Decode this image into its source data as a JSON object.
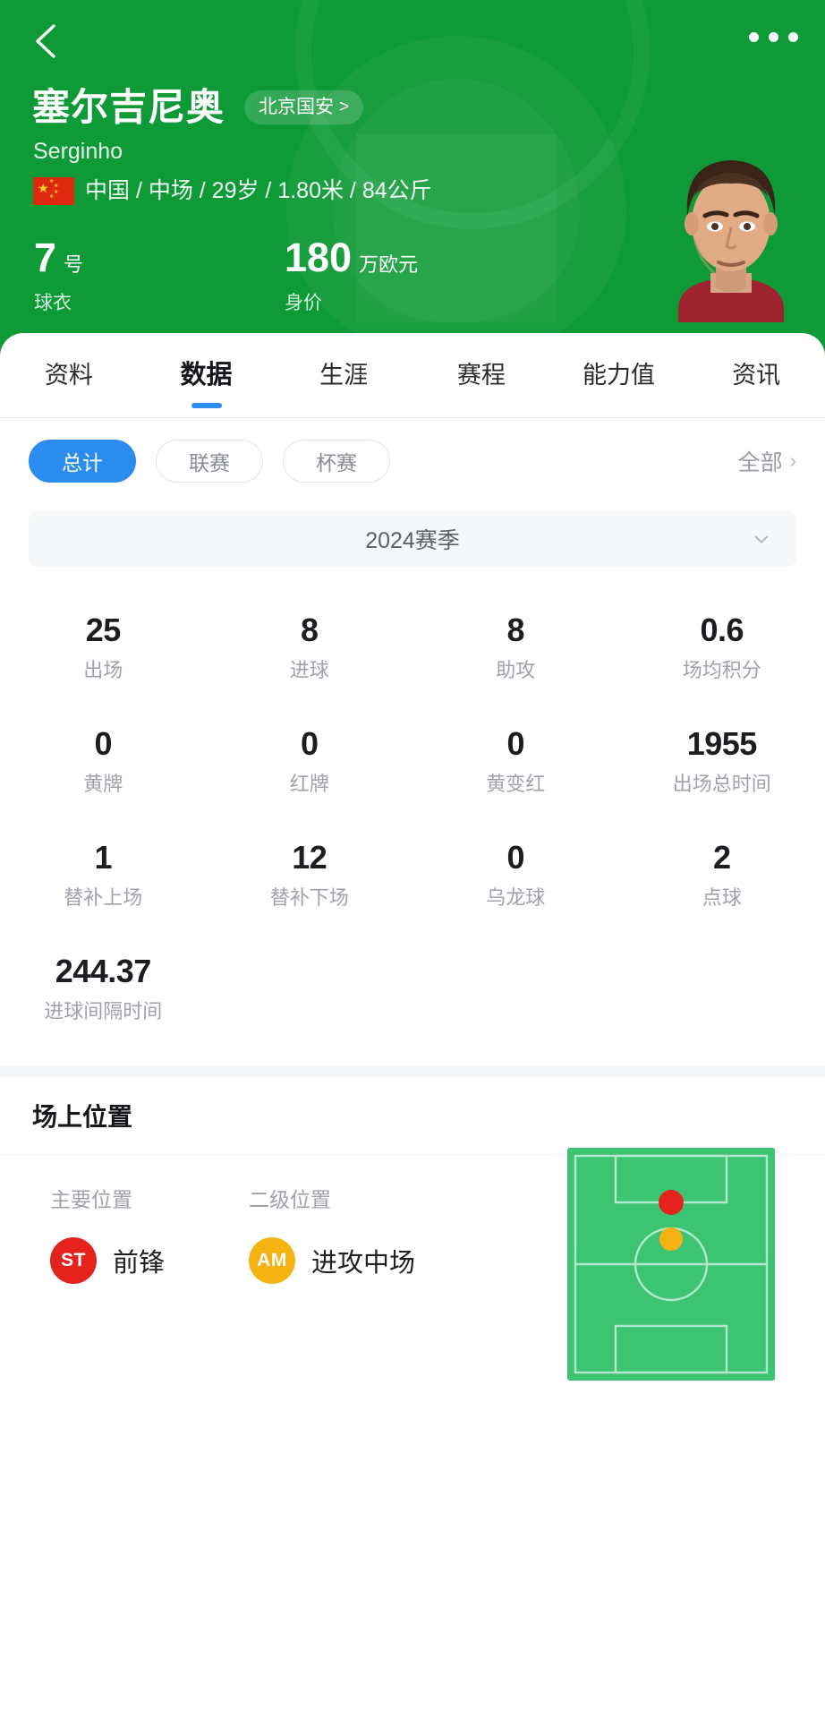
{
  "topbar": {
    "back_icon": "chevron-left-icon",
    "more_icon": "more-horizontal-icon"
  },
  "player": {
    "name": "塞尔吉尼奥",
    "alias": "Serginho",
    "team": "北京国安",
    "team_chevron": ">",
    "nationality_flag": "china-flag-icon",
    "meta": "中国 / 中场 / 29岁 / 1.80米 / 84公斤",
    "photo_alt": "player-portrait",
    "jersey_number": "7",
    "jersey_unit": "号",
    "jersey_label": "球衣",
    "value_number": "180",
    "value_unit": "万欧元",
    "value_label": "身价"
  },
  "theme": {
    "header_green": "#0e9a36",
    "accent_blue": "#2b8cf0",
    "pitch_green": "#3cc472",
    "primary_pos_red": "#e5231e",
    "secondary_pos_orange": "#f6b213"
  },
  "tabs": [
    {
      "label": "资料",
      "active": false
    },
    {
      "label": "数据",
      "active": true
    },
    {
      "label": "生涯",
      "active": false
    },
    {
      "label": "赛程",
      "active": false
    },
    {
      "label": "能力值",
      "active": false
    },
    {
      "label": "资讯",
      "active": false
    }
  ],
  "filters": {
    "chips": [
      {
        "label": "总计",
        "active": true
      },
      {
        "label": "联赛",
        "active": false
      },
      {
        "label": "杯赛",
        "active": false
      }
    ],
    "all_label": "全部",
    "all_chevron": "›"
  },
  "season_selector": {
    "label": "2024赛季",
    "chevron_icon": "chevron-down-icon"
  },
  "stats": [
    {
      "value": "25",
      "label": "出场"
    },
    {
      "value": "8",
      "label": "进球"
    },
    {
      "value": "8",
      "label": "助攻"
    },
    {
      "value": "0.6",
      "label": "场均积分"
    },
    {
      "value": "0",
      "label": "黄牌"
    },
    {
      "value": "0",
      "label": "红牌"
    },
    {
      "value": "0",
      "label": "黄变红"
    },
    {
      "value": "1955",
      "label": "出场总时间"
    },
    {
      "value": "1",
      "label": "替补上场"
    },
    {
      "value": "12",
      "label": "替补下场"
    },
    {
      "value": "0",
      "label": "乌龙球"
    },
    {
      "value": "2",
      "label": "点球"
    },
    {
      "value": "244.37",
      "label": "进球间隔时间"
    }
  ],
  "position_section": {
    "title": "场上位置",
    "primary": {
      "label": "主要位置",
      "badge": "ST",
      "name": "前锋"
    },
    "secondary": {
      "label": "二级位置",
      "badge": "AM",
      "name": "进攻中场"
    },
    "pitch_alt": "football-pitch-diagram"
  }
}
